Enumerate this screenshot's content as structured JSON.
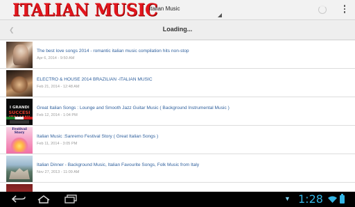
{
  "app": {
    "logo_text": "ITALIAN MUSIC",
    "spinner_value": "Italian Music",
    "loading_text": "Loading..."
  },
  "items": [
    {
      "title": "The best love songs 2014 - romantic italian music compilation hits non-stop",
      "date": "Apr 6, 2014 - 9:50 AM"
    },
    {
      "title": "ELECTRO & HOUSE 2014 BRAZILIAN -ITALIAN MUSIC",
      "date": "Feb 21, 2014 - 12:48 AM"
    },
    {
      "title": "Great Italian Songs : Lounge and Smooth Jazz Guitar Music ( Background Instrumental Music )",
      "date": "Feb 12, 2014 - 1:04 PM"
    },
    {
      "title": "Italian Music :Sanremo Festival Story ( Great Italian Songs )",
      "date": "Feb 11, 2014 - 3:05 PM"
    },
    {
      "title": "Italian Dinner - Background Music, Italian Favourite Songs, Folk Music from Italy",
      "date": "Nov 27, 2013 - 11:09 AM"
    }
  ],
  "thumbs": {
    "t3_line1": "I GRANDI",
    "t3_line2": "SUCCESI ITALIANI",
    "t4_line1": "Festival Story"
  },
  "status": {
    "clock": "1:28"
  },
  "colors": {
    "logo": "#e3161d",
    "title_link": "#2e5f9c",
    "accent_holo": "#33b5e5"
  }
}
